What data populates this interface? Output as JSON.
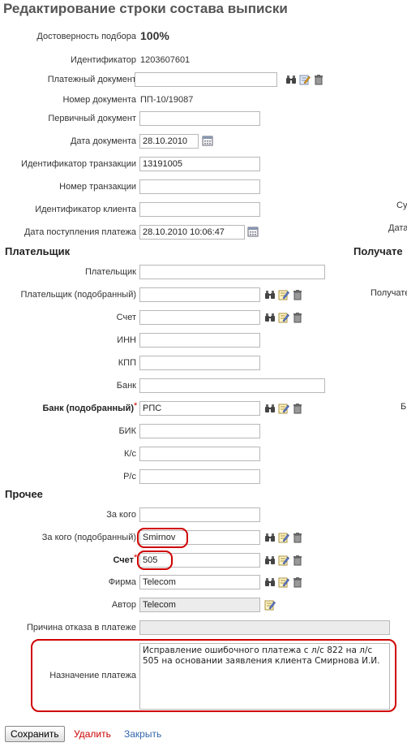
{
  "title": "Редактирование строки состава выписки",
  "header": {
    "confidence_label": "Достоверность подбора",
    "confidence_value": "100%",
    "id_label": "Идентификатор",
    "id_value": "1203607601",
    "payment_doc_label": "Платежный документ",
    "payment_doc_value": "",
    "doc_number_label": "Номер документа",
    "doc_number_value": "ПП-10/19087",
    "primary_doc_label": "Первичный документ",
    "primary_doc_value": "",
    "doc_date_label": "Дата документа",
    "doc_date_value": "28.10.2010",
    "txn_id_label": "Идентификатор транзакции",
    "txn_id_value": "13191005",
    "txn_number_label": "Номер транзакции",
    "txn_number_value": "",
    "client_id_label": "Идентификатор клиента",
    "client_id_value": "",
    "receipt_date_label": "Дата поступления платежа",
    "receipt_date_value": "28.10.2010 10:06:47"
  },
  "right_clipped": {
    "su": "Су",
    "data": "Дата",
    "receiver_section": "Получате",
    "receiver_label": "Получате",
    "b": "Б"
  },
  "payer": {
    "section": "Плательщик",
    "payer_label": "Плательщик",
    "payer_value": "",
    "payer_matched_label": "Плательщик (подобранный)",
    "payer_matched_value": "",
    "account_label": "Счет",
    "account_value": "",
    "inn_label": "ИНН",
    "inn_value": "",
    "kpp_label": "КПП",
    "kpp_value": "",
    "bank_label": "Банк",
    "bank_value": "",
    "bank_matched_label": "Банк (подобранный)",
    "bank_matched_value": "РПС",
    "bik_label": "БИК",
    "bik_value": "",
    "ks_label": "К/с",
    "ks_value": "",
    "rs_label": "Р/с",
    "rs_value": ""
  },
  "other": {
    "section": "Прочее",
    "for_whom_label": "За кого",
    "for_whom_value": "",
    "for_whom_matched_label": "За кого (подобранный)",
    "for_whom_matched_value": "Smirnov",
    "account_label": "Счет",
    "account_value": "505",
    "firm_label": "Фирма",
    "firm_value": "Telecom",
    "author_label": "Автор",
    "author_value": "Telecom",
    "reject_label": "Причина отказа в платеже",
    "reject_value": "",
    "purpose_label": "Назначение платежа",
    "purpose_value": "Исправление ошибочного платежа с л/с 822 на л/с 505 на основании заявления клиента Смирнова И.И."
  },
  "actions": {
    "save": "Сохранить",
    "delete": "Удалить",
    "close": "Закрыть"
  },
  "colors": {
    "required": "#cc0000",
    "highlight": "#d00000",
    "delete_link": "#cc0000",
    "close_link": "#3366aa"
  },
  "icons": [
    "binoculars-icon",
    "edit-icon",
    "trash-icon",
    "calendar-icon"
  ]
}
